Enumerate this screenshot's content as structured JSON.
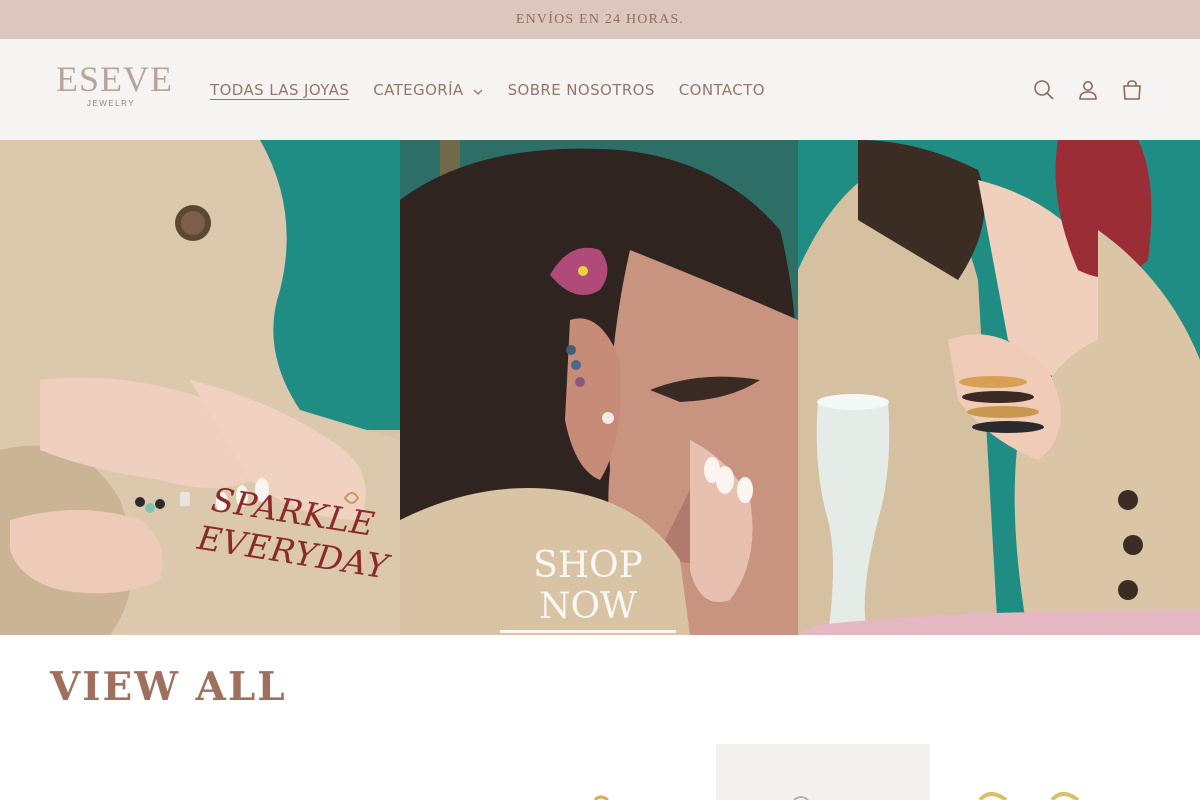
{
  "announcement": {
    "text": "ENVÍOS EN 24 HORAS."
  },
  "brand": {
    "name": "ESEVE",
    "subtitle": "JEWELRY"
  },
  "nav": {
    "items": [
      {
        "label": "TODAS LAS JOYAS",
        "active": true
      },
      {
        "label": "CATEGORÍA",
        "dropdown": true
      },
      {
        "label": "SOBRE NOSOTROS"
      },
      {
        "label": "CONTACTO"
      }
    ]
  },
  "header_icons": [
    "search-icon",
    "account-icon",
    "cart-icon"
  ],
  "hero": {
    "panels": [
      {
        "overlay_line1": "SPARKLE",
        "overlay_line2": "EVERYDAY"
      },
      {
        "cta": "SHOP NOW"
      },
      {}
    ]
  },
  "collection": {
    "title": "VIEW ALL"
  },
  "colors": {
    "announcement_bg": "#dcc7bf",
    "header_bg": "#f6f4f3",
    "accent": "#a0705e",
    "nav_text": "#94776b"
  }
}
